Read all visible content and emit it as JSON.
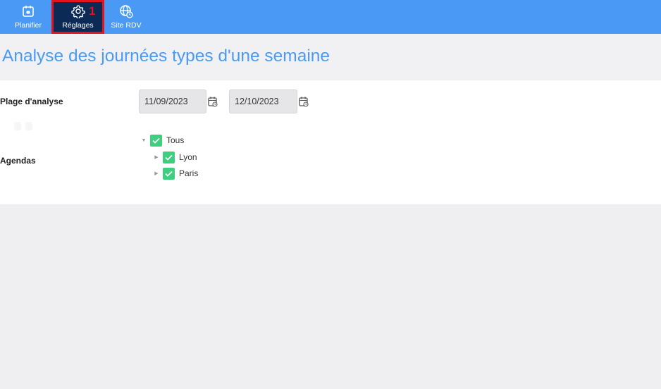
{
  "nav": {
    "items": [
      {
        "label": "Planifier",
        "icon": "calendar-icon"
      },
      {
        "label": "Réglages",
        "icon": "gear-icon",
        "badge": "1"
      },
      {
        "label": "Site RDV",
        "icon": "globe-icon"
      }
    ]
  },
  "page": {
    "title": "Analyse des journées types d'une semaine"
  },
  "form": {
    "range_label": "Plage d'analyse",
    "start_date": "11/09/2023",
    "end_date": "12/10/2023",
    "agendas_label": "Agendas"
  },
  "tree": {
    "root": {
      "label": "Tous",
      "checked": true,
      "expanded": true
    },
    "children": [
      {
        "label": "Lyon",
        "checked": true,
        "expanded": false
      },
      {
        "label": "Paris",
        "checked": true,
        "expanded": false
      }
    ]
  },
  "colors": {
    "accent": "#4a9af5",
    "active_tab": "#0b2a55",
    "highlight": "#e3141e",
    "check": "#3ecf7e"
  }
}
